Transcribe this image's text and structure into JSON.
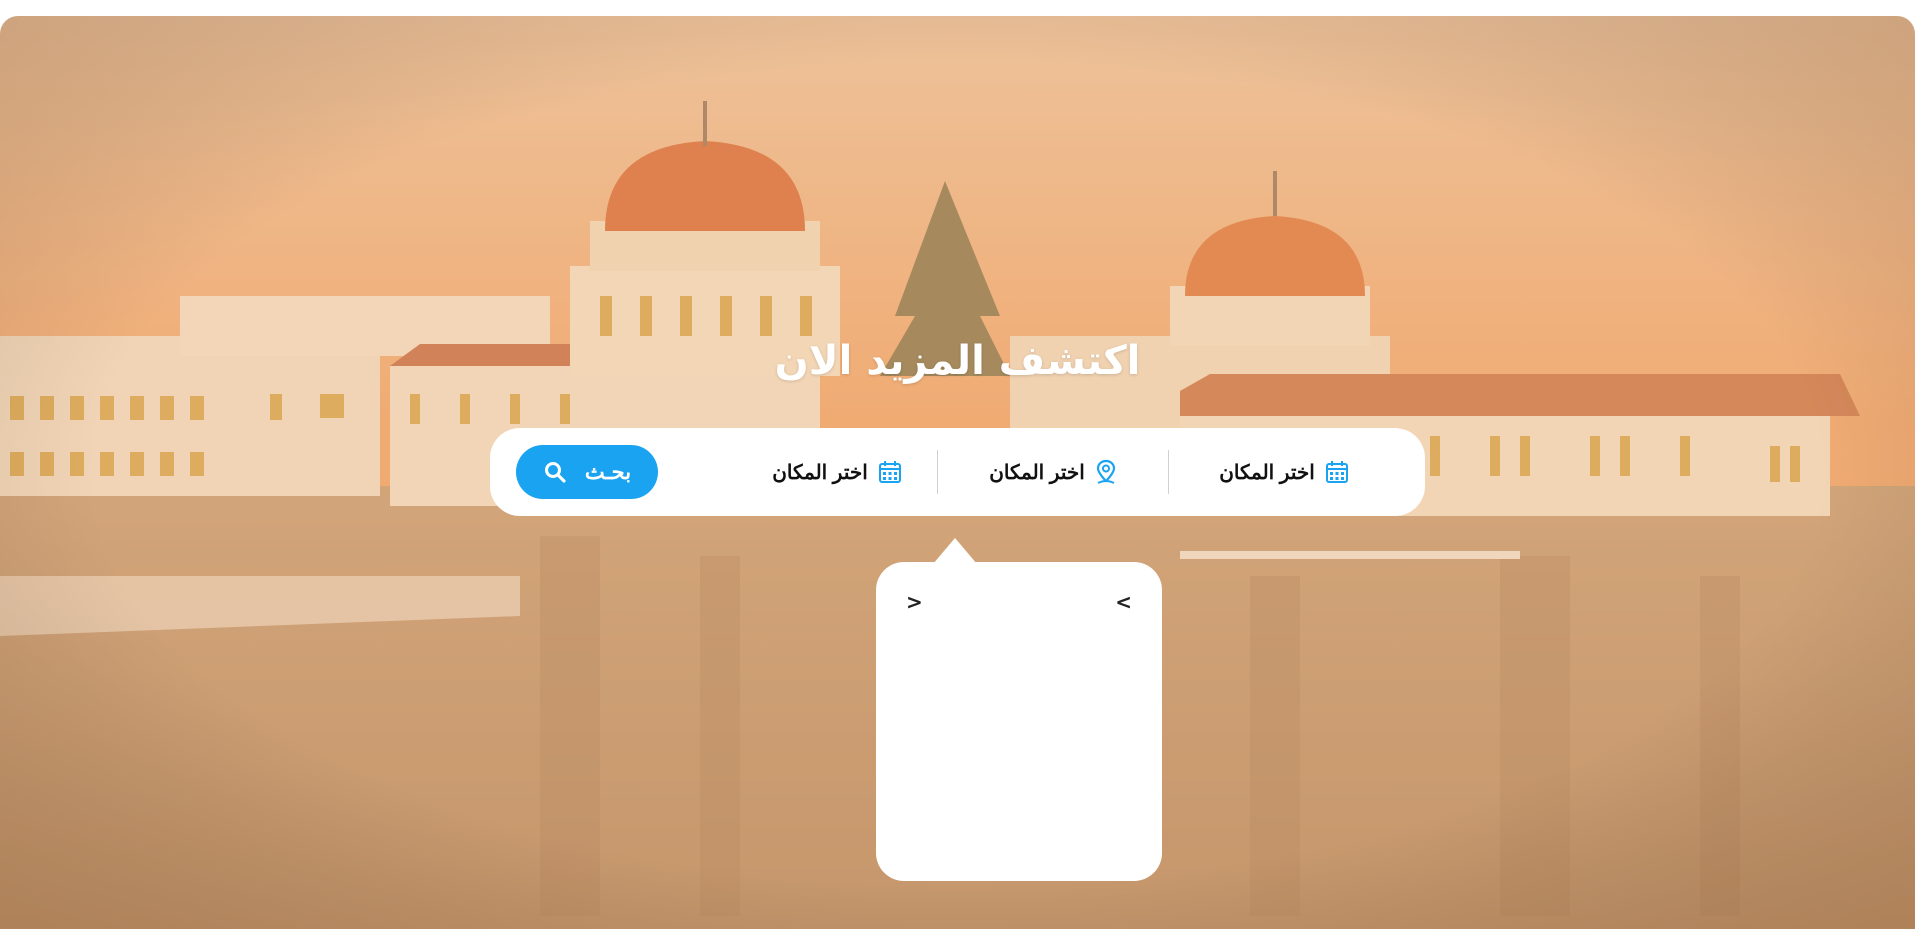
{
  "hero": {
    "title": "اكتشف المزيد الان"
  },
  "search": {
    "fields": [
      {
        "label": "اختر المكان",
        "icon": "calendar-icon"
      },
      {
        "label": "اختر المكان",
        "icon": "location-pin-icon"
      },
      {
        "label": "اختر المكان",
        "icon": "calendar-icon"
      }
    ],
    "button_label": "بحـث",
    "button_icon": "search-icon"
  },
  "calendar_popup": {
    "prev_label": "<",
    "next_label": ">"
  },
  "colors": {
    "accent": "#1aa3f0",
    "overlay": "#f0b37a"
  }
}
